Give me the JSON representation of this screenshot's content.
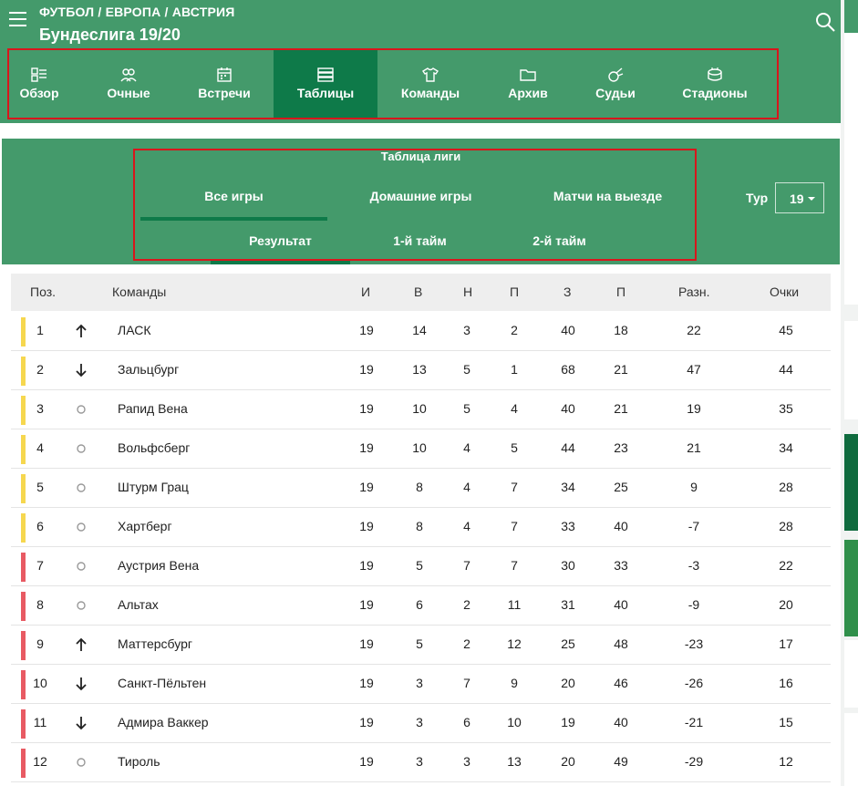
{
  "header": {
    "breadcrumb": "ФУТБОЛ / ЕВРОПА / АВСТРИЯ",
    "title": "Бундеслига 19/20"
  },
  "nav": {
    "tabs": [
      {
        "label": "Обзор",
        "icon": "overview-icon"
      },
      {
        "label": "Очные",
        "icon": "people-icon"
      },
      {
        "label": "Встречи",
        "icon": "calendar-icon"
      },
      {
        "label": "Таблицы",
        "icon": "table-icon",
        "active": true
      },
      {
        "label": "Команды",
        "icon": "shirt-icon"
      },
      {
        "label": "Архив",
        "icon": "folder-icon"
      },
      {
        "label": "Судьи",
        "icon": "whistle-icon"
      },
      {
        "label": "Стадионы",
        "icon": "stadium-icon"
      }
    ]
  },
  "subnav": {
    "title": "Таблица лиги",
    "tabs": [
      "Все игры",
      "Домашние игры",
      "Матчи на выезде"
    ],
    "active_tab": "Все игры",
    "period_tabs": [
      "Результат",
      "1-й тайм",
      "2-й тайм"
    ],
    "active_period": "Результат",
    "tour_label": "Тур",
    "tour_value": "19"
  },
  "table": {
    "columns": [
      "Поз.",
      "Команды",
      "И",
      "В",
      "Н",
      "П",
      "З",
      "П",
      "Разн.",
      "Очки"
    ],
    "rows": [
      {
        "pos": "1",
        "trend": "up",
        "zone": "yellow",
        "team": "ЛАСК",
        "p": "19",
        "w": "14",
        "d": "3",
        "l": "2",
        "gf": "40",
        "ga": "18",
        "gd": "22",
        "pts": "45"
      },
      {
        "pos": "2",
        "trend": "down",
        "zone": "yellow",
        "team": "Зальцбург",
        "p": "19",
        "w": "13",
        "d": "5",
        "l": "1",
        "gf": "68",
        "ga": "21",
        "gd": "47",
        "pts": "44"
      },
      {
        "pos": "3",
        "trend": "same",
        "zone": "yellow",
        "team": "Рапид Вена",
        "p": "19",
        "w": "10",
        "d": "5",
        "l": "4",
        "gf": "40",
        "ga": "21",
        "gd": "19",
        "pts": "35"
      },
      {
        "pos": "4",
        "trend": "same",
        "zone": "yellow",
        "team": "Вольфсберг",
        "p": "19",
        "w": "10",
        "d": "4",
        "l": "5",
        "gf": "44",
        "ga": "23",
        "gd": "21",
        "pts": "34"
      },
      {
        "pos": "5",
        "trend": "same",
        "zone": "yellow",
        "team": "Штурм Грац",
        "p": "19",
        "w": "8",
        "d": "4",
        "l": "7",
        "gf": "34",
        "ga": "25",
        "gd": "9",
        "pts": "28"
      },
      {
        "pos": "6",
        "trend": "same",
        "zone": "yellow",
        "team": "Хартберг",
        "p": "19",
        "w": "8",
        "d": "4",
        "l": "7",
        "gf": "33",
        "ga": "40",
        "gd": "-7",
        "pts": "28"
      },
      {
        "pos": "7",
        "trend": "same",
        "zone": "red",
        "team": "Аустрия Вена",
        "p": "19",
        "w": "5",
        "d": "7",
        "l": "7",
        "gf": "30",
        "ga": "33",
        "gd": "-3",
        "pts": "22"
      },
      {
        "pos": "8",
        "trend": "same",
        "zone": "red",
        "team": "Альтах",
        "p": "19",
        "w": "6",
        "d": "2",
        "l": "11",
        "gf": "31",
        "ga": "40",
        "gd": "-9",
        "pts": "20"
      },
      {
        "pos": "9",
        "trend": "up",
        "zone": "red",
        "team": "Маттерсбург",
        "p": "19",
        "w": "5",
        "d": "2",
        "l": "12",
        "gf": "25",
        "ga": "48",
        "gd": "-23",
        "pts": "17"
      },
      {
        "pos": "10",
        "trend": "down",
        "zone": "red",
        "team": "Санкт-Пёльтен",
        "p": "19",
        "w": "3",
        "d": "7",
        "l": "9",
        "gf": "20",
        "ga": "46",
        "gd": "-26",
        "pts": "16"
      },
      {
        "pos": "11",
        "trend": "down",
        "zone": "red",
        "team": "Адмира Ваккер",
        "p": "19",
        "w": "3",
        "d": "6",
        "l": "10",
        "gf": "19",
        "ga": "40",
        "gd": "-21",
        "pts": "15"
      },
      {
        "pos": "12",
        "trend": "same",
        "zone": "red",
        "team": "Тироль",
        "p": "19",
        "w": "3",
        "d": "3",
        "l": "13",
        "gf": "20",
        "ga": "49",
        "gd": "-29",
        "pts": "12"
      }
    ]
  },
  "colors": {
    "header_green": "#449a6b",
    "active_tab_green": "#0e7a49",
    "zone_yellow": "#f6d74f",
    "zone_red": "#e85a63",
    "highlight_red": "#d8161c"
  }
}
